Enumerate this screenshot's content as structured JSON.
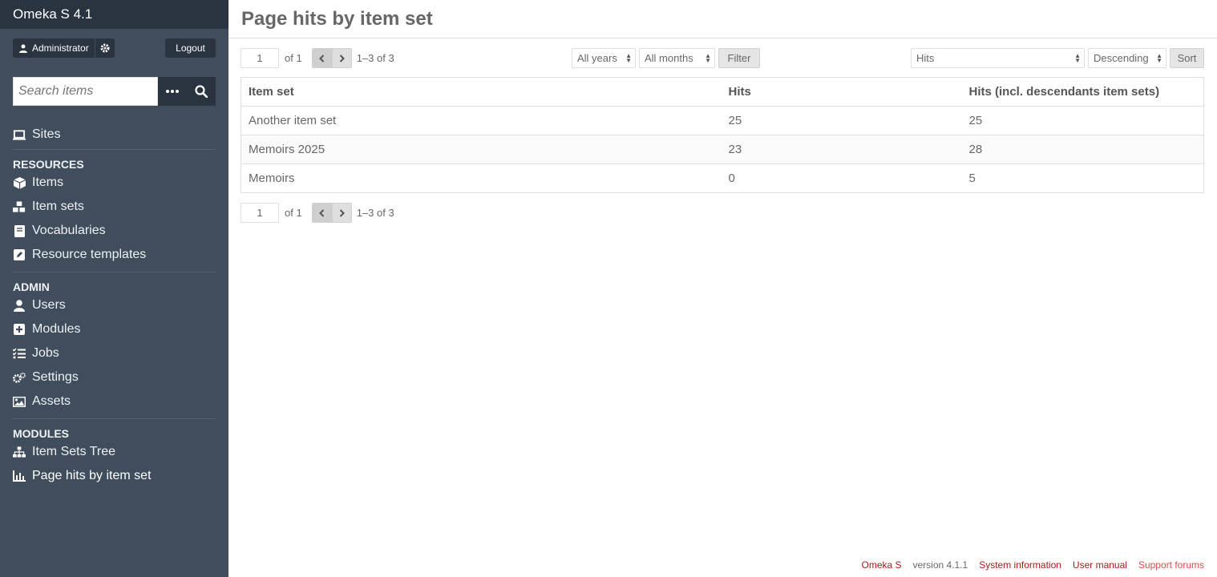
{
  "app": {
    "title": "Omeka S 4.1"
  },
  "user": {
    "name": "Administrator",
    "logout_label": "Logout"
  },
  "search": {
    "placeholder": "Search items"
  },
  "nav": {
    "sites": "Sites",
    "resources_label": "RESOURCES",
    "resources": [
      "Items",
      "Item sets",
      "Vocabularies",
      "Resource templates"
    ],
    "admin_label": "ADMIN",
    "admin": [
      "Users",
      "Modules",
      "Jobs",
      "Settings",
      "Assets"
    ],
    "modules_label": "MODULES",
    "modules": [
      "Item Sets Tree",
      "Page hits by item set"
    ]
  },
  "page": {
    "title": "Page hits by item set"
  },
  "pagination": {
    "page": "1",
    "of_label": "of 1",
    "range": "1–3 of 3"
  },
  "filter": {
    "year": "All years",
    "month": "All months",
    "button": "Filter"
  },
  "sort": {
    "by": "Hits",
    "order": "Descending",
    "button": "Sort"
  },
  "table": {
    "headers": [
      "Item set",
      "Hits",
      "Hits (incl. descendants item sets)"
    ],
    "rows": [
      [
        "Another item set",
        "25",
        "25"
      ],
      [
        "Memoirs 2025",
        "23",
        "28"
      ],
      [
        "Memoirs",
        "0",
        "5"
      ]
    ]
  },
  "footer": {
    "brand": "Omeka S",
    "version": "version 4.1.1",
    "system_info": "System information",
    "manual": "User manual",
    "forums": "Support forums"
  },
  "colors": {
    "sidebar": "#3f4d5c",
    "brand_bar": "#2a3441",
    "link": "#a91919"
  }
}
